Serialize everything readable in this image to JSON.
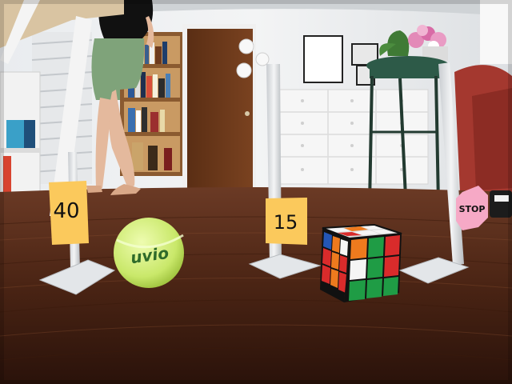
{
  "photo": {
    "signs": {
      "left": "40",
      "middle": "15",
      "stop": "STOP"
    },
    "ball_brand": "uvio"
  }
}
